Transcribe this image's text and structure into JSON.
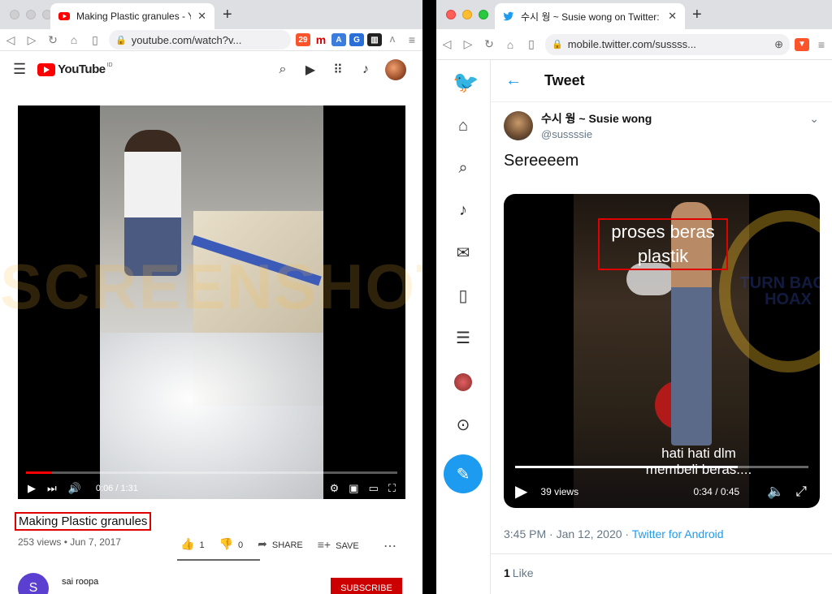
{
  "left_window": {
    "tab": {
      "title": "Making Plastic granules - YouTube",
      "close": "✕"
    },
    "new_tab": "+",
    "url": "youtube.com/watch?v...",
    "brave_badge": "29",
    "youtube": {
      "logo_text": "YouTube",
      "region": "ID",
      "video": {
        "current_time": "0:06 / 1:31",
        "progress": 0.07
      },
      "title": "Making Plastic granules",
      "meta": "253 views • Jun 7, 2017",
      "likes": "1",
      "dislikes": "0",
      "share_label": "SHARE",
      "save_label": "SAVE",
      "channel": {
        "initial": "S",
        "name": "sai roopa"
      },
      "subscribe_label": "SUBSCRIBE"
    },
    "watermark": "SCREENSHOT BY"
  },
  "right_window": {
    "tab": {
      "title": "수시 웡 ~ Susie wong on Twitter: \"S",
      "close": "✕"
    },
    "new_tab": "+",
    "url": "mobile.twitter.com/sussss...",
    "tweet": {
      "header": "Tweet",
      "author_name": "수시 웡 ~ Susie wong",
      "handle": "@sussssie",
      "text": "Sereeeem",
      "video": {
        "caption_top": "proses beras plastik",
        "caption_bottom": "hati hati dlm membeli beras....",
        "views": "39 views",
        "time": "0:34 / 0:45",
        "progress": 0.76,
        "stamp_text": "TURN BACK HOAX"
      },
      "date": "3:45 PM · Jan 12, 2020 · ",
      "source": "Twitter for Android",
      "likes_count": "1",
      "likes_label": "Like"
    }
  },
  "colors": {
    "youtube_red": "#ff0000",
    "twitter_blue": "#1d9bf0",
    "highlight_box": "#e10000"
  }
}
